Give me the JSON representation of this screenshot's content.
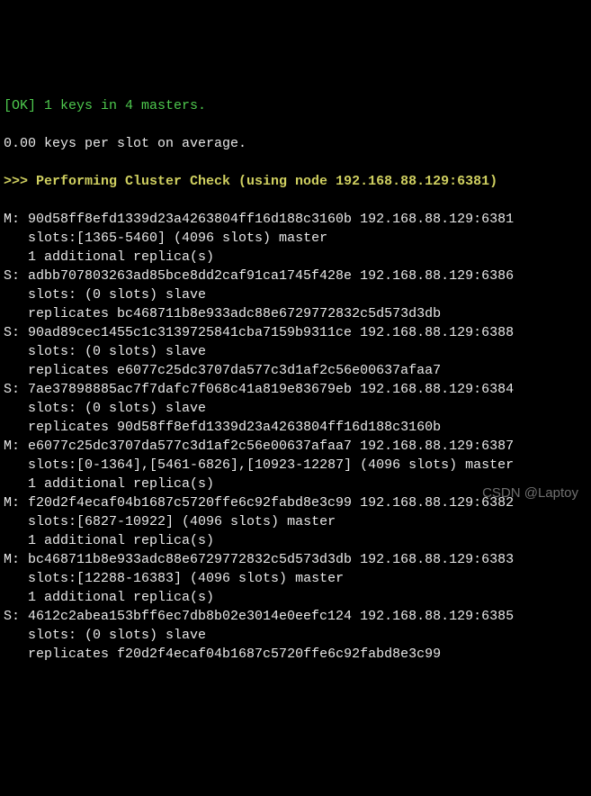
{
  "header": {
    "ok_prefix": "[OK] ",
    "ok_text": "1 keys in 4 masters.",
    "avg": "0.00 keys per slot on average.",
    "check_prefix": ">>> Performing Cluster Check ",
    "check_node": "(using node 192.168.88.129:6381)"
  },
  "nodes": [
    {
      "prefix": "M: ",
      "hash": "90d58ff8efd1339d23a4263804ff16d188c3160b",
      "addr": " 192.168.88.129:6381",
      "line2": "   slots:[1365-5460] (4096 slots) master",
      "line3": "   1 additional replica(s)"
    },
    {
      "prefix": "S: ",
      "hash": "adbb707803263ad85bce8dd2caf91ca1745f428e",
      "addr": " 192.168.88.129:6386",
      "line2": "   slots: (0 slots) slave",
      "line3": "   replicates bc468711b8e933adc88e6729772832c5d573d3db"
    },
    {
      "prefix": "S: ",
      "hash": "90ad89cec1455c1c3139725841cba7159b9311ce",
      "addr": " 192.168.88.129:6388",
      "line2": "   slots: (0 slots) slave",
      "line3": "   replicates e6077c25dc3707da577c3d1af2c56e00637afaa7"
    },
    {
      "prefix": "S: ",
      "hash": "7ae37898885ac7f7dafc7f068c41a819e83679eb",
      "addr": " 192.168.88.129:6384",
      "line2": "   slots: (0 slots) slave",
      "line3": "   replicates 90d58ff8efd1339d23a4263804ff16d188c3160b"
    },
    {
      "prefix": "M: ",
      "hash": "e6077c25dc3707da577c3d1af2c56e00637afaa7",
      "addr": " 192.168.88.129:6387",
      "line2": "   slots:[0-1364],[5461-6826],[10923-12287] (4096 slots) master",
      "line3": "   1 additional replica(s)"
    },
    {
      "prefix": "M: ",
      "hash": "f20d2f4ecaf04b1687c5720ffe6c92fabd8e3c99",
      "addr": " 192.168.88.129:6382",
      "line2": "   slots:[6827-10922] (4096 slots) master",
      "line3": "   1 additional replica(s)"
    },
    {
      "prefix": "M: ",
      "hash": "bc468711b8e933adc88e6729772832c5d573d3db",
      "addr": " 192.168.88.129:6383",
      "line2": "   slots:[12288-16383] (4096 slots) master",
      "line3": "   1 additional replica(s)"
    },
    {
      "prefix": "S: ",
      "hash": "4612c2abea153bff6ec7db8b02e3014e0eefc124",
      "addr": " 192.168.88.129:6385",
      "line2": "   slots: (0 slots) slave",
      "line3": "   replicates f20d2f4ecaf04b1687c5720ffe6c92fabd8e3c99"
    }
  ],
  "watermark": "CSDN @Laptoy"
}
